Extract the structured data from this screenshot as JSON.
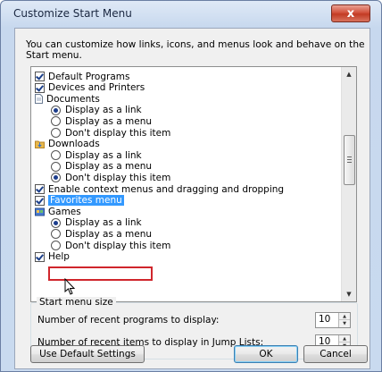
{
  "window": {
    "title": "Customize Start Menu",
    "close_glyph": "x"
  },
  "description": "You can customize how links, icons, and menus look and behave on the Start menu.",
  "items": [
    {
      "label": "Default Programs",
      "kind": "checkbox",
      "checked": true
    },
    {
      "label": "Devices and Printers",
      "kind": "checkbox",
      "checked": true
    },
    {
      "label": "Documents",
      "kind": "heading",
      "icon": "document-icon"
    },
    {
      "label": "Display as a link",
      "kind": "radio",
      "checked": true
    },
    {
      "label": "Display as a menu",
      "kind": "radio",
      "checked": false
    },
    {
      "label": "Don't display this item",
      "kind": "radio",
      "checked": false
    },
    {
      "label": "Downloads",
      "kind": "heading",
      "icon": "folder-icon"
    },
    {
      "label": "Display as a link",
      "kind": "radio",
      "checked": false
    },
    {
      "label": "Display as a menu",
      "kind": "radio",
      "checked": false
    },
    {
      "label": "Don't display this item",
      "kind": "radio",
      "checked": true
    },
    {
      "label": "Enable context menus and dragging and dropping",
      "kind": "checkbox",
      "checked": true
    },
    {
      "label": "Favorites menu",
      "kind": "checkbox",
      "checked": true,
      "selected": true
    },
    {
      "label": "Games",
      "kind": "heading",
      "icon": "games-icon"
    },
    {
      "label": "Display as a link",
      "kind": "radio",
      "checked": true
    },
    {
      "label": "Display as a menu",
      "kind": "radio",
      "checked": false
    },
    {
      "label": "Don't display this item",
      "kind": "radio",
      "checked": false
    },
    {
      "label": "Help",
      "kind": "checkbox",
      "checked": true
    }
  ],
  "start_menu_size": {
    "group_label": "Start menu size",
    "recent_programs_label": "Number of recent programs to display:",
    "recent_programs_value": "10",
    "recent_items_label": "Number of recent items to display in Jump Lists:",
    "recent_items_value": "10"
  },
  "buttons": {
    "default_settings": "Use Default Settings",
    "ok": "OK",
    "cancel": "Cancel"
  },
  "colors": {
    "selection": "#3399ff",
    "highlight_box": "#d0262c",
    "close_button": "#c23b24"
  }
}
